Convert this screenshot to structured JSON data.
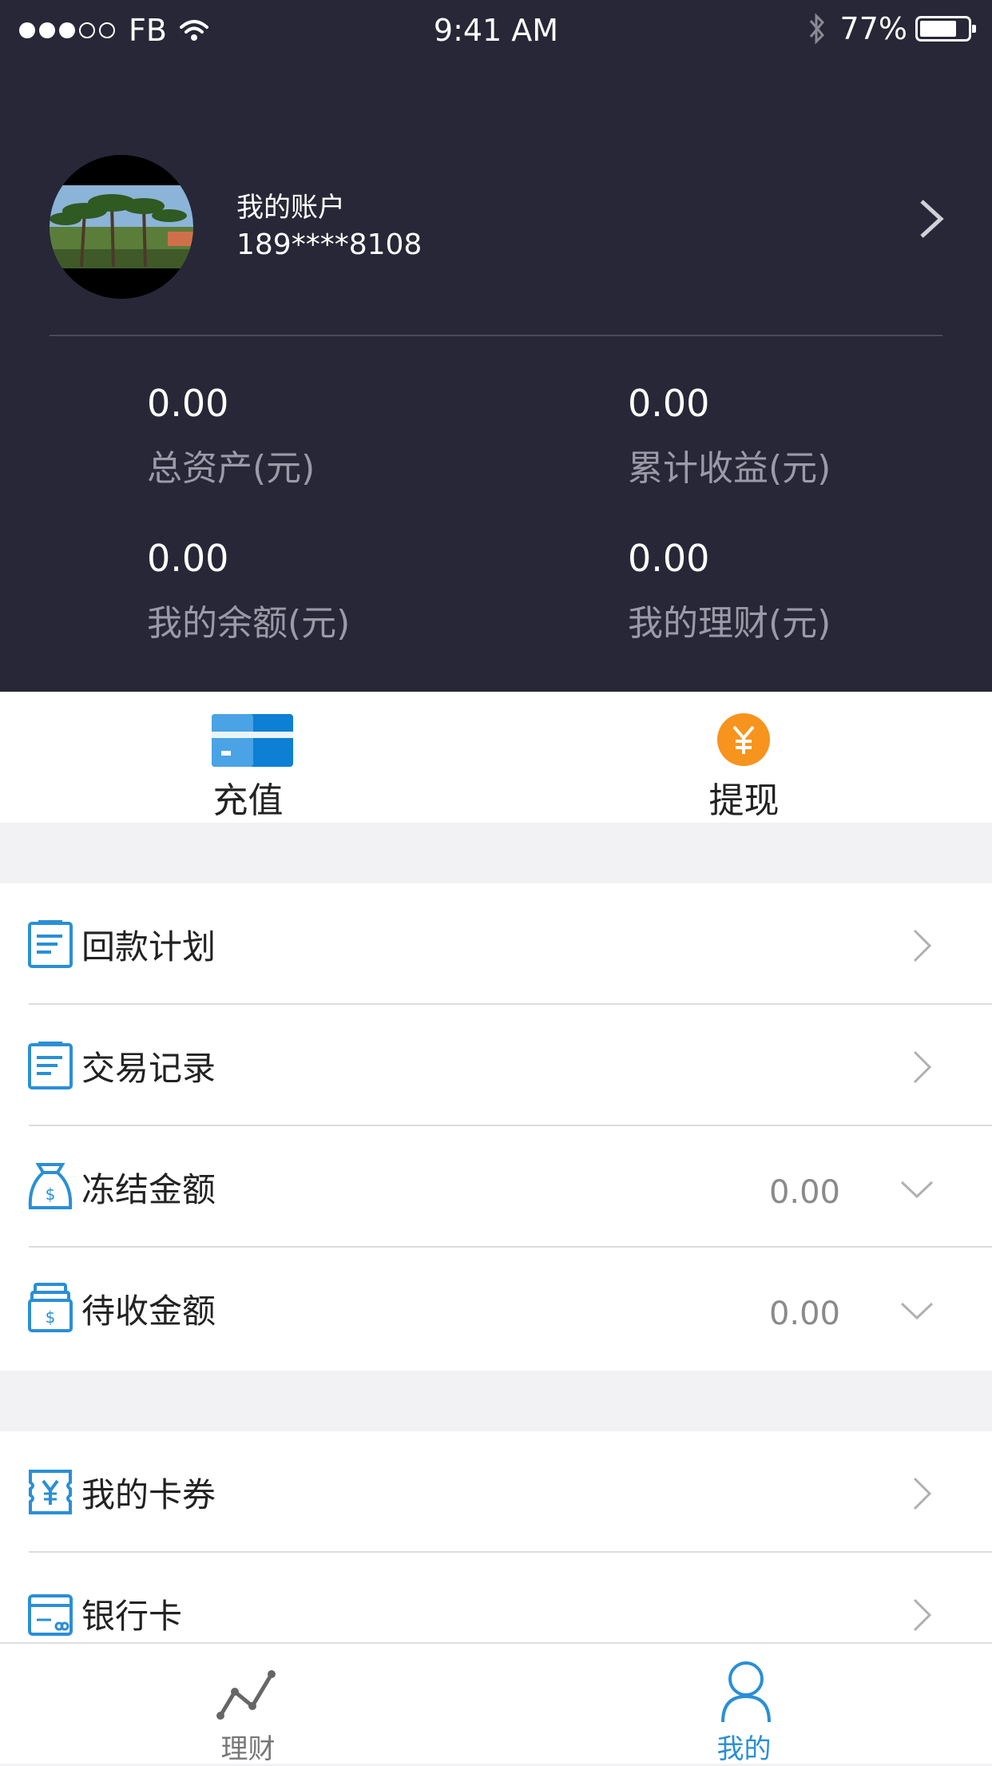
{
  "status_bar": {
    "carrier": "FB",
    "time": "9:41 AM",
    "battery": "77%",
    "battery_level": 0.77
  },
  "account": {
    "title": "我的账户",
    "phone": "189****8108"
  },
  "stats": [
    {
      "value": "0.00",
      "label": "总资产(元)"
    },
    {
      "value": "0.00",
      "label": "累计收益(元)"
    },
    {
      "value": "0.00",
      "label": "我的余额(元)"
    },
    {
      "value": "0.00",
      "label": "我的理财(元)"
    }
  ],
  "actions": {
    "recharge": "充值",
    "withdraw": "提现"
  },
  "menu": [
    {
      "label": "回款计划",
      "icon": "document-icon"
    },
    {
      "label": "交易记录",
      "icon": "document-icon"
    },
    {
      "label": "冻结金额",
      "icon": "money-bag-icon",
      "value": "0.00"
    },
    {
      "label": "待收金额",
      "icon": "money-stack-icon",
      "value": "0.00"
    },
    {
      "label": "我的卡券",
      "icon": "coupon-icon"
    },
    {
      "label": "银行卡",
      "icon": "bank-card-icon"
    }
  ],
  "tabs": [
    {
      "label": "理财",
      "icon": "trend-line-icon",
      "active": false
    },
    {
      "label": "我的",
      "icon": "person-icon",
      "active": true
    }
  ],
  "colors": {
    "header_bg": "#272737",
    "accent": "#2a8fd6",
    "orange": "#f7941d"
  }
}
